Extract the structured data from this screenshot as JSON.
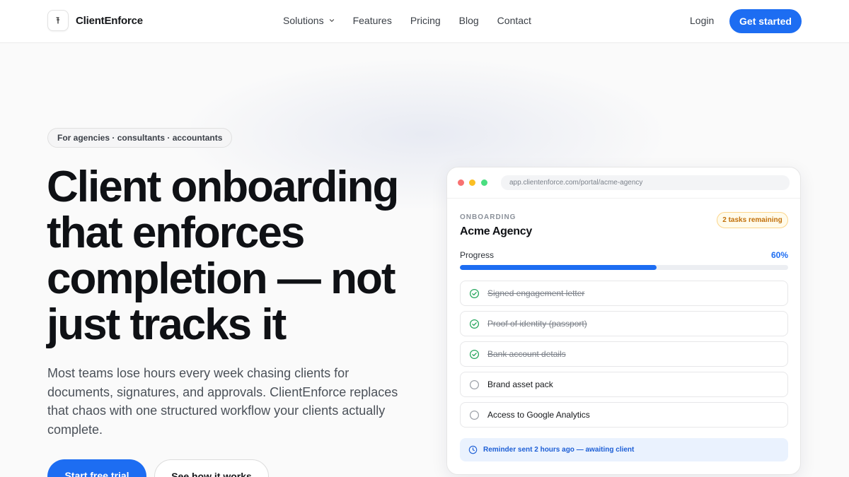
{
  "brand": {
    "name": "ClientEnforce"
  },
  "nav": {
    "links": [
      "Solutions",
      "Features",
      "Pricing",
      "Blog",
      "Contact"
    ],
    "login": "Login",
    "cta": "Get started"
  },
  "hero": {
    "pill": "For agencies · consultants · accountants",
    "headline": "Client onboarding that enforces completion — not just tracks it",
    "subtext": "Most teams lose hours every week chasing clients for documents, signatures, and approvals. ClientEnforce replaces that chaos with one structured workflow your clients actually complete.",
    "primary_cta": "Start free trial",
    "secondary_cta": "See how it works"
  },
  "portal": {
    "url": "app.clientenforce.com/portal/acme-agency",
    "section_label": "ONBOARDING",
    "client_name": "Acme Agency",
    "badge": "2 tasks remaining",
    "progress_label": "Progress",
    "progress_text": "60%",
    "progress_fraction": 0.6,
    "tasks": [
      {
        "label": "Signed engagement letter",
        "done": true
      },
      {
        "label": "Proof of identity (passport)",
        "done": true
      },
      {
        "label": "Bank account details",
        "done": true
      },
      {
        "label": "Brand asset pack",
        "done": false
      },
      {
        "label": "Access to Google Analytics",
        "done": false
      }
    ],
    "reminder": "Reminder sent 2 hours ago — awaiting client"
  },
  "colors": {
    "accent": "#1d6df2",
    "success": "#22a55a",
    "warning": "#c2700a"
  }
}
